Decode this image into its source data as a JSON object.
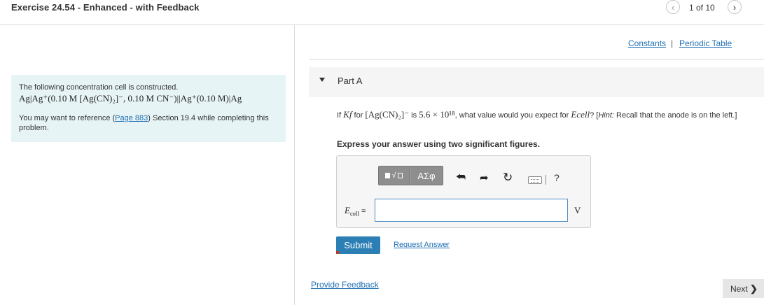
{
  "header": {
    "title": "Exercise 24.54 - Enhanced - with Feedback",
    "counter": "1 of 10",
    "prev_icon": "chevron-left-icon",
    "next_icon": "chevron-right-icon"
  },
  "left_panel": {
    "intro": "The following concentration cell is constructed.",
    "cell_notation": "Ag|Ag⁺(0.10 M [Ag(CN)₂]⁻, 0.10 M CN⁻)||Ag⁺(0.10 M)|Ag",
    "ref_prefix": "You may want to reference (",
    "ref_link": "Page 883",
    "ref_suffix": ") Section 19.4 while completing this problem."
  },
  "links": {
    "constants": "Constants",
    "separator": "|",
    "periodic_table": "Periodic Table"
  },
  "part": {
    "label": "Part A",
    "question_1": "If ",
    "question_kf": "Kf",
    "question_2": " for ",
    "question_complex": "[Ag(CN)₂]⁻",
    "question_3": " is ",
    "question_value": "5.6 × 10¹⁸",
    "question_4": ", what value would you expect for ",
    "question_ecell": "Ecell",
    "question_5": "? [",
    "question_hint_label": "Hint:",
    "question_6": " Recall that the anode is on the left.]",
    "express": "Express your answer using two significant figures."
  },
  "answer": {
    "symbols_label": "ΑΣφ",
    "templates_label": "√",
    "help_label": "?",
    "ecell_label_main": "E",
    "ecell_label_sub": "cell",
    "ecell_label_eq": " =",
    "input_value": "",
    "unit": "V"
  },
  "actions": {
    "submit": "Submit",
    "request_answer": "Request Answer",
    "provide_feedback": "Provide Feedback",
    "next": "Next"
  }
}
